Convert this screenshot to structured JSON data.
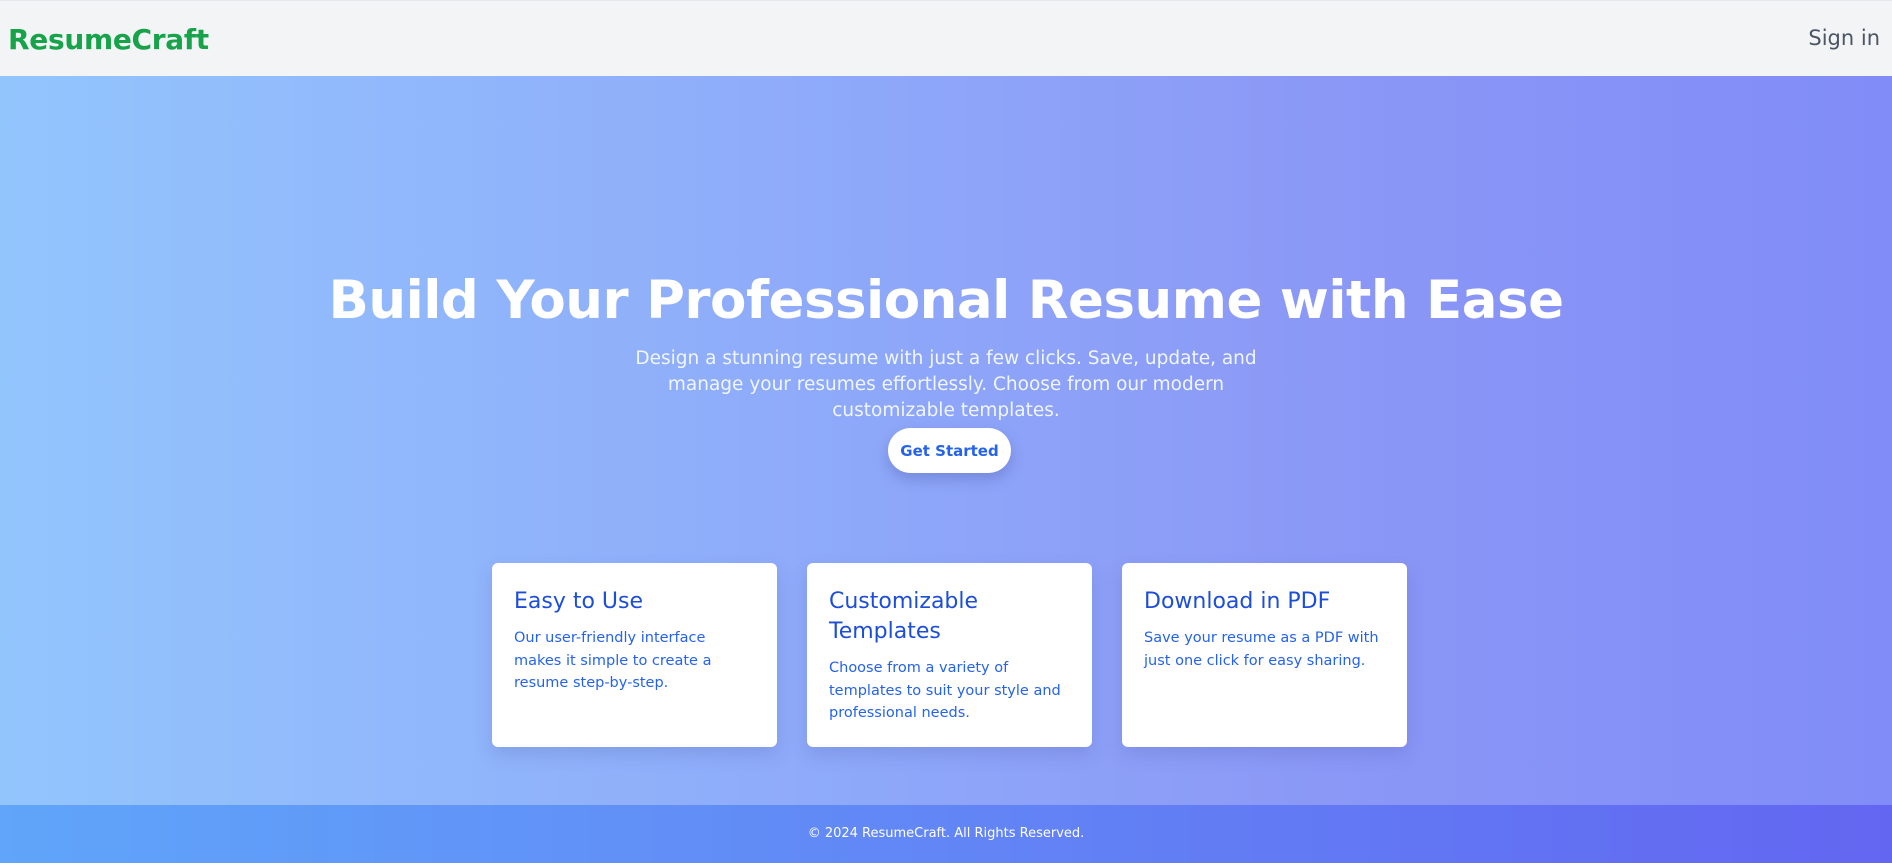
{
  "navbar": {
    "brand": "ResumeCraft",
    "signin_label": "Sign in"
  },
  "hero": {
    "title": "Build Your Professional Resume with Ease",
    "subtitle": "Design a stunning resume with just a few clicks. Save, update, and manage your resumes effortlessly. Choose from our modern customizable templates.",
    "cta_label": "Get Started"
  },
  "features": [
    {
      "title": "Easy to Use",
      "description": "Our user-friendly interface makes it simple to create a resume step-by-step."
    },
    {
      "title": "Customizable Templates",
      "description": "Choose from a variety of templates to suit your style and professional needs."
    },
    {
      "title": "Download in PDF",
      "description": "Save your resume as a PDF with just one click for easy sharing."
    }
  ],
  "footer": {
    "text": "© 2024 ResumeCraft. All Rights Reserved."
  },
  "colors": {
    "brand": "#16a34a",
    "accent": "#2563eb",
    "hero_gradient_start": "#93c5fd",
    "hero_gradient_end": "#818cf8",
    "footer_gradient_start": "#60a5fa",
    "footer_gradient_end": "#6366f1"
  }
}
